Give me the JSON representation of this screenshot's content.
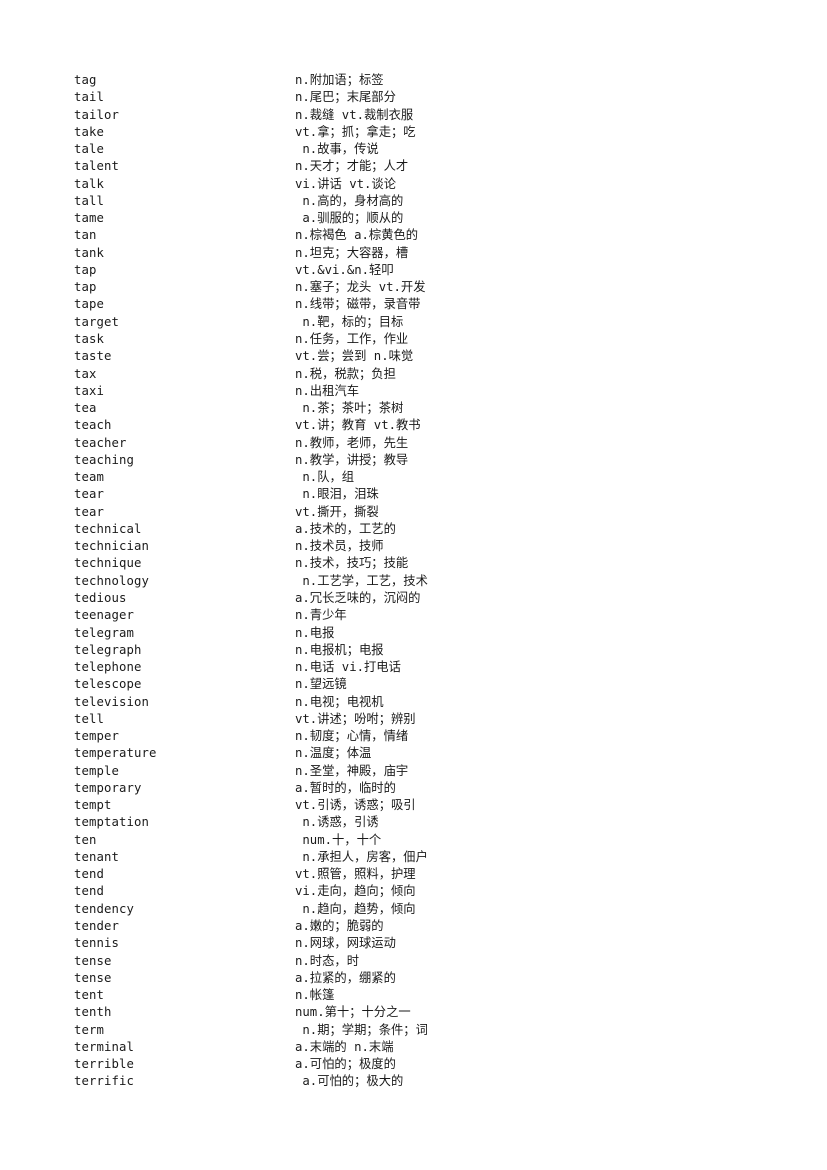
{
  "document": {
    "type": "vocabulary-glossary",
    "language_pair": "English-Chinese",
    "page_background": "#ffffff",
    "text_color": "#1a1a1a"
  },
  "entries": [
    {
      "word": "tag",
      "definition": "n.附加语；标签"
    },
    {
      "word": "tail",
      "definition": "n.尾巴；末尾部分"
    },
    {
      "word": "tailor",
      "definition": "n.裁缝 vt.裁制衣服"
    },
    {
      "word": "take",
      "definition": "vt.拿；抓；拿走；吃"
    },
    {
      "word": "tale",
      "definition": " n.故事，传说"
    },
    {
      "word": "talent",
      "definition": "n.天才；才能；人才"
    },
    {
      "word": "talk",
      "definition": "vi.讲话 vt.谈论"
    },
    {
      "word": "tall",
      "definition": " n.高的，身材高的"
    },
    {
      "word": "tame",
      "definition": " a.驯服的；顺从的"
    },
    {
      "word": "tan",
      "definition": "n.棕褐色 a.棕黄色的"
    },
    {
      "word": "tank",
      "definition": "n.坦克；大容器，槽"
    },
    {
      "word": "tap",
      "definition": "vt.&vi.&n.轻叩"
    },
    {
      "word": "tap",
      "definition": "n.塞子；龙头 vt.开发"
    },
    {
      "word": "tape",
      "definition": "n.线带；磁带，录音带"
    },
    {
      "word": "target",
      "definition": " n.靶，标的；目标"
    },
    {
      "word": "task",
      "definition": "n.任务，工作，作业"
    },
    {
      "word": "taste",
      "definition": "vt.尝；尝到 n.味觉"
    },
    {
      "word": "tax",
      "definition": "n.税，税款；负担"
    },
    {
      "word": "taxi",
      "definition": "n.出租汽车"
    },
    {
      "word": "tea",
      "definition": " n.茶；茶叶；茶树"
    },
    {
      "word": "teach",
      "definition": "vt.讲；教育 vt.教书"
    },
    {
      "word": "teacher",
      "definition": "n.教师，老师，先生"
    },
    {
      "word": "teaching",
      "definition": "n.教学，讲授；教导"
    },
    {
      "word": "team",
      "definition": " n.队，组"
    },
    {
      "word": "tear",
      "definition": " n.眼泪，泪珠"
    },
    {
      "word": "tear",
      "definition": "vt.撕开，撕裂"
    },
    {
      "word": "technical",
      "definition": "a.技术的，工艺的"
    },
    {
      "word": "technician",
      "definition": "n.技术员，技师"
    },
    {
      "word": "technique",
      "definition": "n.技术，技巧；技能"
    },
    {
      "word": "technology",
      "definition": " n.工艺学，工艺，技术"
    },
    {
      "word": "tedious",
      "definition": "a.冗长乏味的，沉闷的"
    },
    {
      "word": "teenager",
      "definition": "n.青少年"
    },
    {
      "word": "telegram",
      "definition": "n.电报"
    },
    {
      "word": "telegraph",
      "definition": "n.电报机；电报"
    },
    {
      "word": "telephone",
      "definition": "n.电话 vi.打电话"
    },
    {
      "word": "telescope",
      "definition": "n.望远镜"
    },
    {
      "word": "television",
      "definition": "n.电视；电视机"
    },
    {
      "word": "tell",
      "definition": "vt.讲述；吩咐；辨别"
    },
    {
      "word": "temper",
      "definition": "n.韧度；心情，情绪"
    },
    {
      "word": "temperature",
      "definition": "n.温度；体温"
    },
    {
      "word": "temple",
      "definition": "n.圣堂，神殿，庙宇"
    },
    {
      "word": "temporary",
      "definition": "a.暂时的，临时的"
    },
    {
      "word": "tempt",
      "definition": "vt.引诱，诱惑；吸引"
    },
    {
      "word": "temptation",
      "definition": " n.诱惑，引诱"
    },
    {
      "word": "ten",
      "definition": " num.十，十个"
    },
    {
      "word": "tenant",
      "definition": " n.承担人，房客，佃户"
    },
    {
      "word": "tend",
      "definition": "vt.照管，照料，护理"
    },
    {
      "word": "tend",
      "definition": "vi.走向，趋向；倾向"
    },
    {
      "word": "tendency",
      "definition": " n.趋向，趋势，倾向"
    },
    {
      "word": "tender",
      "definition": "a.嫩的；脆弱的"
    },
    {
      "word": "tennis",
      "definition": "n.网球，网球运动"
    },
    {
      "word": "tense",
      "definition": "n.时态，时"
    },
    {
      "word": "tense",
      "definition": "a.拉紧的，绷紧的"
    },
    {
      "word": "tent",
      "definition": "n.帐篷"
    },
    {
      "word": "tenth",
      "definition": "num.第十；十分之一"
    },
    {
      "word": "term",
      "definition": " n.期；学期；条件；词"
    },
    {
      "word": "terminal",
      "definition": "a.末端的 n.末端"
    },
    {
      "word": "terrible",
      "definition": "a.可怕的；极度的"
    },
    {
      "word": "terrific",
      "definition": " a.可怕的；极大的"
    }
  ]
}
